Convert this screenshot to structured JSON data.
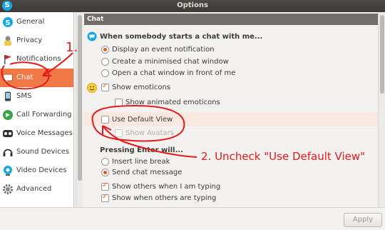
{
  "window": {
    "title": "Options",
    "app_icon": "S"
  },
  "sidebar": {
    "items": [
      {
        "label": "General",
        "icon": "skype-icon",
        "active": false
      },
      {
        "label": "Privacy",
        "icon": "privacy-icon",
        "active": false
      },
      {
        "label": "Notifications",
        "icon": "flag-icon",
        "active": false
      },
      {
        "label": "Chat",
        "icon": "chat-bubble-icon",
        "active": true
      },
      {
        "label": "SMS",
        "icon": "phone-icon",
        "active": false
      },
      {
        "label": "Call Forwarding",
        "icon": "call-forward-icon",
        "active": false
      },
      {
        "label": "Voice Messages",
        "icon": "voicemail-icon",
        "active": false
      },
      {
        "label": "Sound Devices",
        "icon": "headset-icon",
        "active": false
      },
      {
        "label": "Video Devices",
        "icon": "webcam-icon",
        "active": false
      },
      {
        "label": "Advanced",
        "icon": "gear-icon",
        "active": false
      }
    ]
  },
  "main": {
    "section_title": "Chat",
    "chat_start": {
      "heading": "When somebody starts a chat with me...",
      "options": [
        {
          "label": "Display an event notification",
          "selected": true
        },
        {
          "label": "Create a minimised chat window",
          "selected": false
        },
        {
          "label": "Open a chat window in front of me",
          "selected": false
        }
      ]
    },
    "emoticons": {
      "show_emoticons": {
        "label": "Show emoticons",
        "checked": true
      },
      "show_animated": {
        "label": "Show animated emoticons",
        "checked": false
      }
    },
    "view": {
      "use_default_view": {
        "label": "Use Default View",
        "checked": false
      },
      "show_avatars": {
        "label": "Show Avatars",
        "checked": false
      }
    },
    "enter": {
      "heading": "Pressing Enter will...",
      "options": [
        {
          "label": "Insert line break",
          "selected": false
        },
        {
          "label": "Send chat message",
          "selected": true
        }
      ]
    },
    "typing": {
      "show_others_when_i": {
        "label": "Show others when I am typing",
        "checked": true
      },
      "show_when_others": {
        "label": "Show when others are typing",
        "checked": true
      }
    }
  },
  "footer": {
    "apply_label": "Apply"
  },
  "annotations": {
    "step1": "1.",
    "step2": "2. Uncheck \"Use Default View\"",
    "color": "#e31b1b"
  },
  "colors": {
    "accent": "#f07746",
    "radio_dot": "#e9591f",
    "header": "#6f6e6a"
  }
}
